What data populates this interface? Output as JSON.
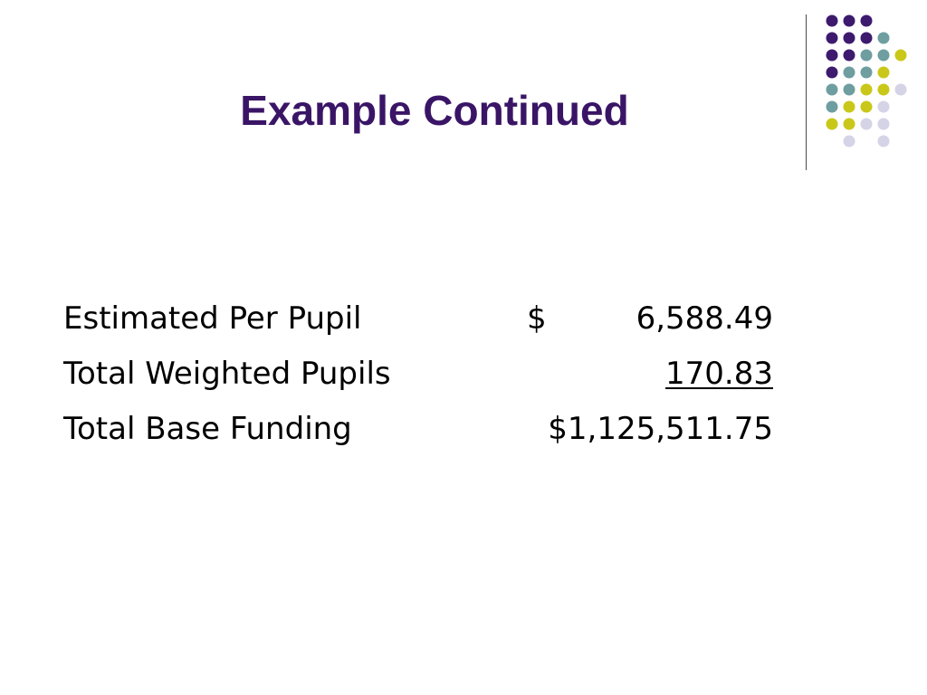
{
  "slide": {
    "title": "Example Continued",
    "rows": [
      {
        "label": "Estimated Per Pupil",
        "currency": "$",
        "amount": "6,588.49",
        "underlined": false
      },
      {
        "label": "Total Weighted Pupils",
        "currency": "",
        "amount": "170.83",
        "underlined": true
      },
      {
        "label": "Total Base Funding",
        "currency": "",
        "amount": "$1,125,511.75",
        "underlined": false
      }
    ]
  },
  "theme": {
    "title_color": "#3a1566",
    "dot_colors": {
      "purple": "#3d1a6e",
      "teal": "#6e9ea0",
      "yellow": "#c9c81a",
      "lavender": "#d5d3e6"
    }
  },
  "decoration": {
    "icon": "dot-grid-icon",
    "rows": [
      [
        "purple",
        "purple",
        "purple",
        "",
        ""
      ],
      [
        "purple",
        "purple",
        "purple",
        "teal",
        ""
      ],
      [
        "purple",
        "purple",
        "teal",
        "teal",
        "yellow"
      ],
      [
        "purple",
        "teal",
        "teal",
        "yellow",
        ""
      ],
      [
        "teal",
        "teal",
        "yellow",
        "yellow",
        "lavender"
      ],
      [
        "teal",
        "yellow",
        "yellow",
        "lavender",
        ""
      ],
      [
        "yellow",
        "yellow",
        "lavender",
        "lavender",
        ""
      ],
      [
        "",
        "lavender",
        "",
        "lavender",
        ""
      ]
    ]
  }
}
